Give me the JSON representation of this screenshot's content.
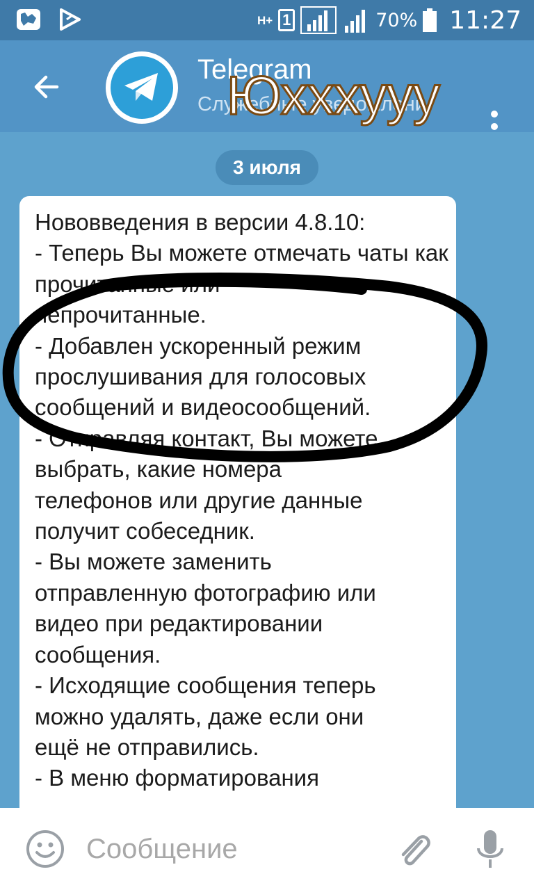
{
  "status_bar": {
    "network_type": "H+",
    "sim_label": "1",
    "battery": "70%",
    "time": "11:27",
    "icons": [
      "map-notification-icon",
      "play-store-notification-icon",
      "signal-icon",
      "battery-icon"
    ]
  },
  "header": {
    "title": "Telegram",
    "subtitle": "Служебные уведомления",
    "overlay_caption": "Юxxxyyy"
  },
  "chat": {
    "date": "3 июля",
    "message": "Нововведения в версии 4.8.10:\n- Теперь Вы можете отмечать чаты как прочитанные или\nнепрочитанные.\n- Добавлен ускоренный режим\nпрослушивания для голосовых\nсообщений и видеосообщений.\n- Отправляя контакт, Вы можете\nвыбрать, какие номера\nтелефонов или другие данные\nполучит собеседник.\n- Вы можете заменить\nотправленную фотографию или\nвидео при редактировании\nсообщения.\n- Исходящие сообщения теперь\nможно удалять, даже если они\nещё не отправились.\n- В меню форматирования"
  },
  "composer": {
    "placeholder": "Сообщение"
  },
  "colors": {
    "status_bar": "#3f7aa8",
    "header": "#5294c6",
    "chat_background": "#5ea2cd",
    "bubble": "#ffffff",
    "scribble": "#000000",
    "overlay_stroke": "#7a4a13"
  }
}
